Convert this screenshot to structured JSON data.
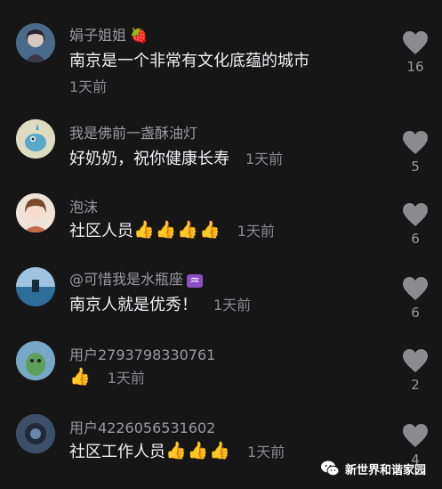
{
  "comments": [
    {
      "user": "娟子姐姐",
      "user_badge": "strawberry-icon",
      "text": "南京是一个非常有文化底蕴的城市",
      "time": "1天前",
      "likes": "16"
    },
    {
      "user": "我是佛前一盏酥油灯",
      "text": "好奶奶，祝你健康长寿",
      "time": "1天前",
      "likes": "5"
    },
    {
      "user": "泡沫",
      "text": "社区人员",
      "emoji": [
        "👍",
        "👍",
        "👍",
        "👍"
      ],
      "time": "1天前",
      "likes": "6"
    },
    {
      "user": "@可惜我是水瓶座",
      "user_badge": "aquarius-icon",
      "text": "南京人就是优秀！",
      "time": "1天前",
      "likes": "6"
    },
    {
      "user": "用户2793798330761",
      "text": "",
      "emoji": [
        "👍"
      ],
      "time": "1天前",
      "likes": "2"
    },
    {
      "user": "用户4226056531602",
      "text": "社区工作人员",
      "emoji": [
        "👍",
        "👍",
        "👍"
      ],
      "time": "1天前",
      "likes": "4"
    }
  ],
  "watermark": {
    "text": "新世界和谐家园",
    "icon": "wechat-icon"
  },
  "colors": {
    "background": "#161617",
    "name": "#9a9a9e",
    "text": "#f0f0f2",
    "heart": "#8c8c90"
  }
}
